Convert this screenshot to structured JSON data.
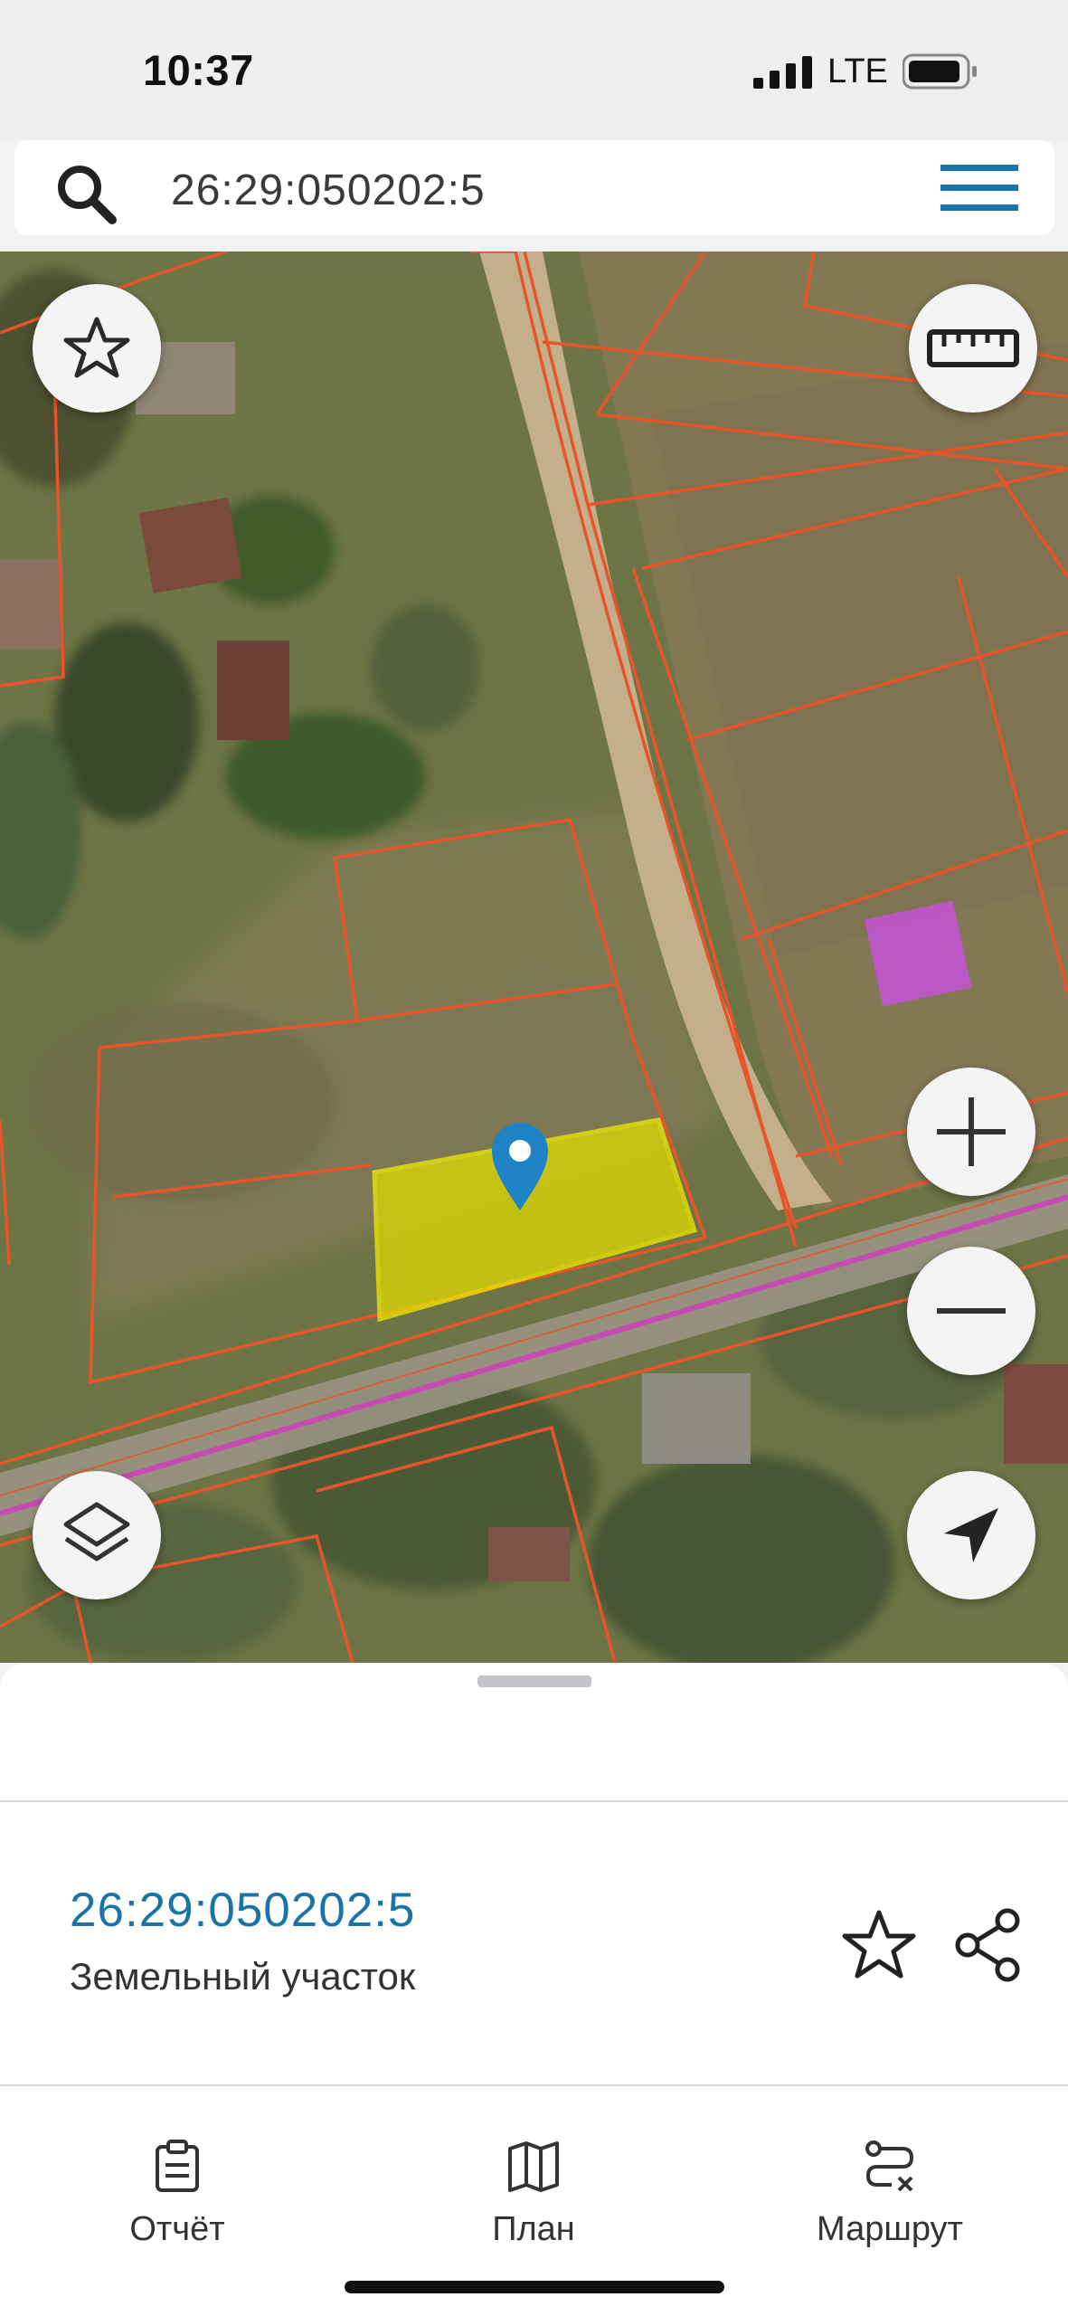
{
  "status_bar": {
    "time": "10:37",
    "network": "LTE"
  },
  "search": {
    "query": "26:29:050202:5",
    "icon": "search-icon"
  },
  "header": {
    "menu_icon": "hamburger-menu-icon"
  },
  "map": {
    "type": "satellite",
    "controls": [
      "favorite-star-icon",
      "ruler-icon",
      "zoom-in-icon",
      "zoom-out-icon",
      "layers-icon",
      "locate-arrow-icon"
    ],
    "colors": {
      "parcel_border": "#e8542a",
      "selected_parcel": "#e3e000",
      "selected_border": "#f5f000",
      "road_line": "#c84ab5",
      "marker": "#1f84c6",
      "building_zone": "#c652d9"
    }
  },
  "sheet": {
    "parcel_id": "26:29:050202:5",
    "parcel_type": "Земельный участок",
    "actions": [
      "star-icon",
      "share-icon"
    ]
  },
  "bottom_nav": [
    {
      "label": "Отчёт",
      "icon": "report-clipboard-icon"
    },
    {
      "label": "План",
      "icon": "map-plan-icon"
    },
    {
      "label": "Маршрут",
      "icon": "route-icon"
    }
  ]
}
